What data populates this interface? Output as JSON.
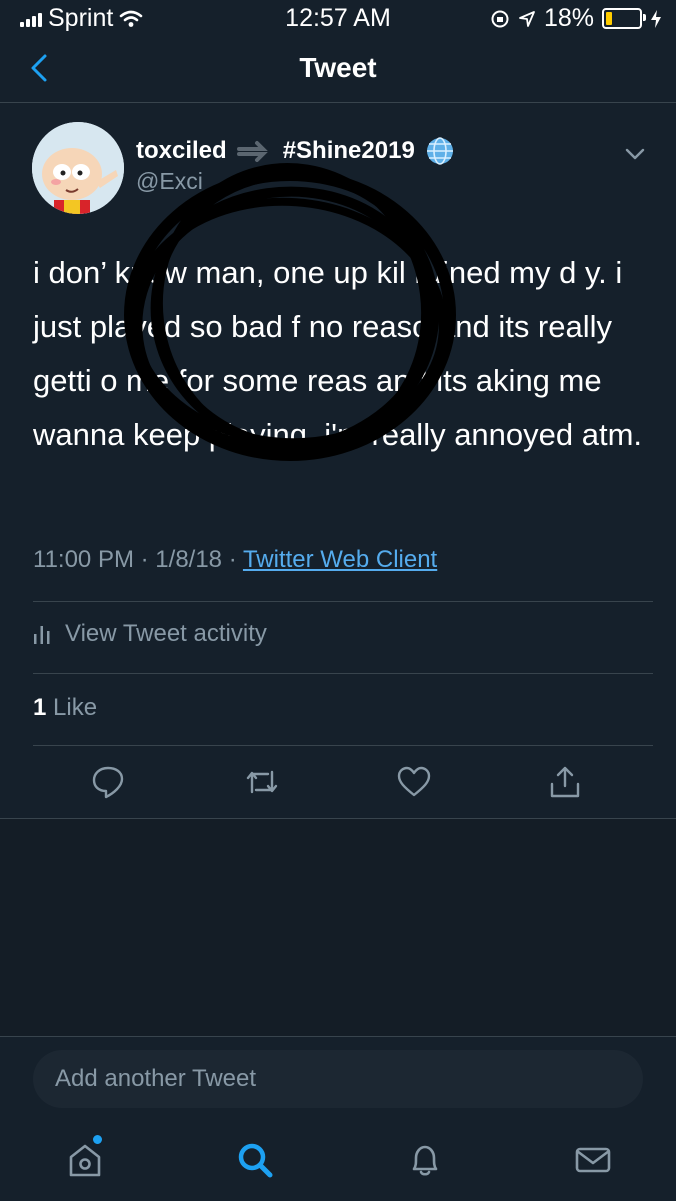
{
  "status_bar": {
    "carrier": "Sprint",
    "time": "12:57 AM",
    "battery_percent": "18%",
    "battery_level": 0.18
  },
  "header": {
    "title": "Tweet",
    "back_icon": "chevron-left-icon"
  },
  "tweet": {
    "display_name": "toxciled",
    "name_suffix": "#Shine2019",
    "handle": "@Exci",
    "text": "i don’ know man, one up kil ruined my d y. i just played so bad f no reaso and its really getti o me for some reas and its aking me wanna keep playing. i'm really annoyed atm.",
    "time": "11:00 PM",
    "date": "1/8/18",
    "separator": "·",
    "client": "Twitter Web Client",
    "activity_label": "View Tweet activity",
    "like_count": "1",
    "like_label": "Like"
  },
  "actions": [
    "reply-icon",
    "retweet-icon",
    "like-icon",
    "share-icon"
  ],
  "reply": {
    "placeholder": "Add another Tweet"
  },
  "tabbar": [
    "home-icon",
    "search-icon",
    "notifications-icon",
    "messages-icon"
  ],
  "colors": {
    "background": "#15202b",
    "accent": "#1da1f2",
    "link": "#55acee",
    "secondary_text": "#8899a6",
    "border": "#38444d"
  }
}
